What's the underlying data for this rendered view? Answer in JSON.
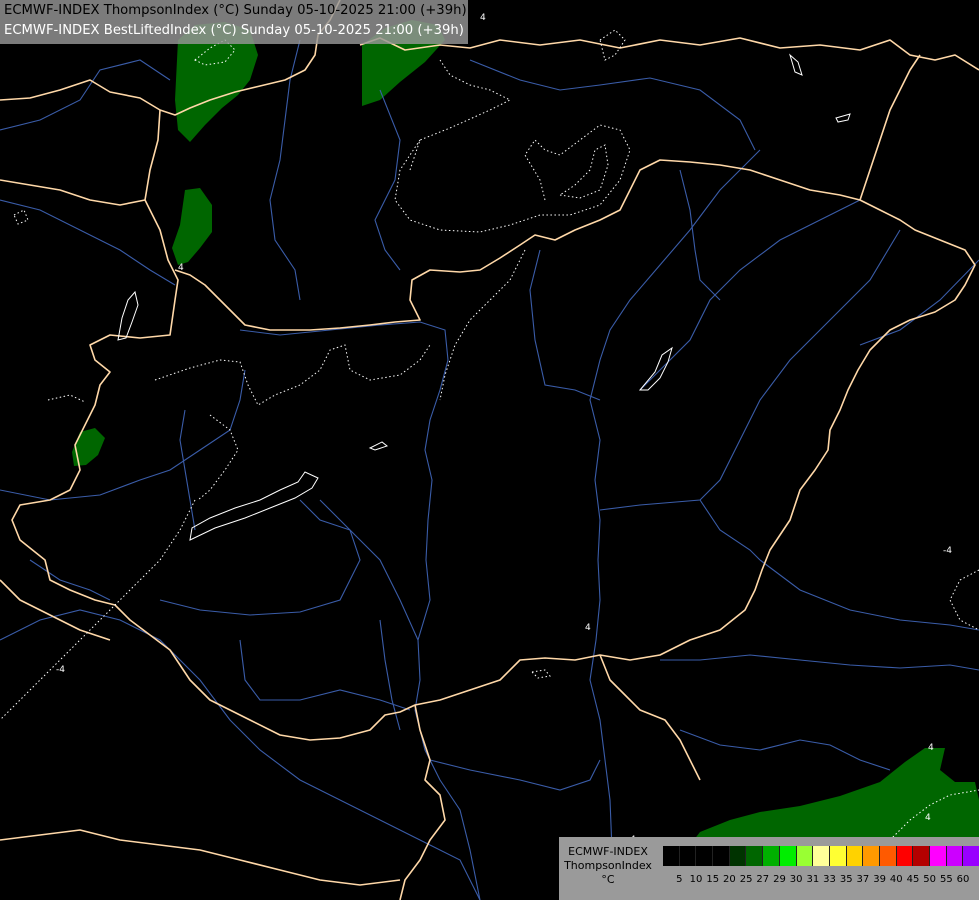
{
  "header": {
    "line1": "ECMWF-INDEX ThompsonIndex (°C) Sunday 05-10-2025 21:00 (+39h)",
    "line2": "ECMWF-INDEX BestLiftedIndex (°C) Sunday 05-10-2025 21:00 (+39h)"
  },
  "legend": {
    "title_line1": "ECMWF-INDEX",
    "title_line2": "ThompsonIndex",
    "title_line3": "°C",
    "swatch_colors": [
      "#000000",
      "#000000",
      "#000000",
      "#000000",
      "#003300",
      "#006600",
      "#00b000",
      "#00ee00",
      "#99ff33",
      "#ffff99",
      "#ffff33",
      "#ffd200",
      "#ff9900",
      "#ff5a00",
      "#ff0000",
      "#b40000",
      "#ff00ff",
      "#cc00ff",
      "#9900ff",
      "#5500ff",
      "#0000ff"
    ],
    "tick_labels": [
      "5",
      "10",
      "15",
      "20",
      "25",
      "27",
      "29",
      "30",
      "31",
      "33",
      "35",
      "37",
      "39",
      "40",
      "45",
      "50",
      "55",
      "60"
    ]
  },
  "map": {
    "background_color": "#000000",
    "field_color": "#006600",
    "border_color": "#ffd8a8",
    "river_color": "#3a5ca8",
    "contour_color": "#ffffff",
    "contour_labels": [
      "4",
      "-4",
      "-4",
      "4",
      "4",
      "4",
      "4",
      "4"
    ]
  }
}
